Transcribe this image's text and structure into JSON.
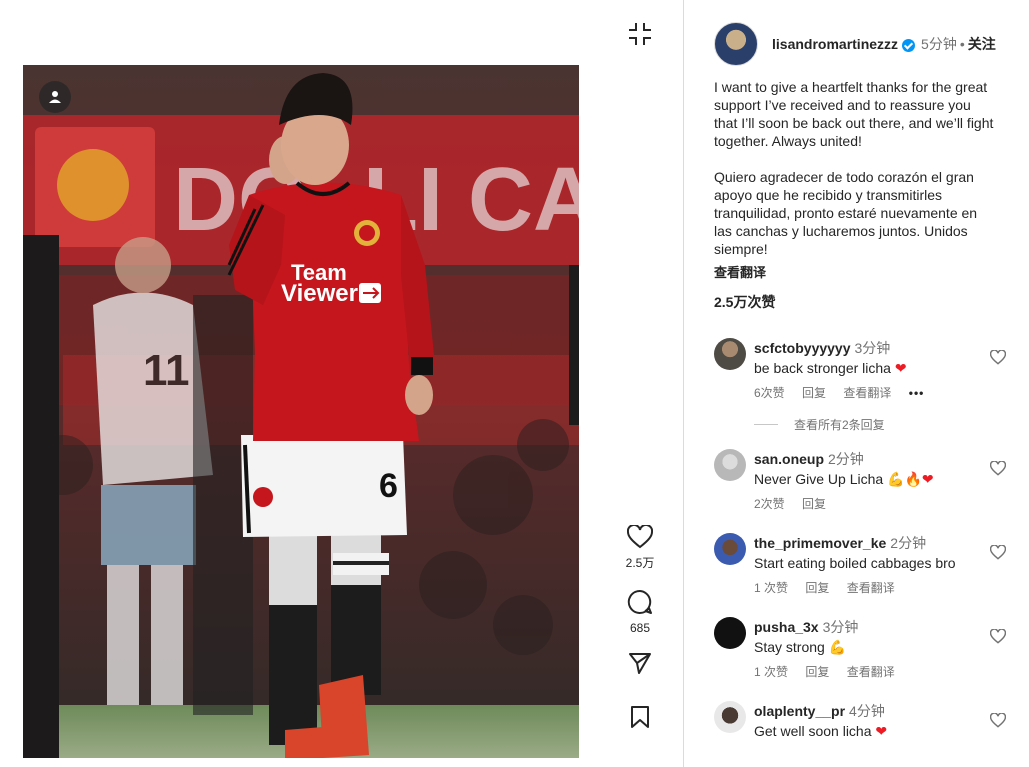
{
  "post": {
    "author": "lisandromartinezzz",
    "time": "5分钟",
    "dot": "•",
    "follow_label": "关注",
    "caption": "I want to give a heartfelt thanks for the great support I’ve received and to reassure you that I’ll soon be back out there, and we’ll fight together. Always united!\n\nQuiero agradecer de todo corazón el gran apoyo que he recibido y transmitirles tranquilidad, pronto estaré nuevamente en las canchas y lucharemos juntos. Unidos siempre!",
    "see_translation": "查看翻译",
    "likes_text": "2.5万次赞"
  },
  "actions": {
    "like_count": "2.5万",
    "comment_count": "685"
  },
  "media": {
    "sponsor_line1": "Team",
    "sponsor_line2": "Viewer",
    "shirt_number_player": "6",
    "shirt_number_background": "11"
  },
  "comments": [
    {
      "user": "scfctobyyyyyy",
      "time": "3分钟",
      "text": "be back stronger licha ",
      "emoji": "❤",
      "likes": "6次赞",
      "reply": "回复",
      "translate": "查看翻译",
      "more": "•••"
    },
    {
      "user": "san.oneup",
      "time": "2分钟",
      "text": "Never Give Up Licha ",
      "emoji": "💪🔥❤",
      "likes": "2次赞",
      "reply": "回复"
    },
    {
      "user": "the_primemover_ke",
      "time": "2分钟",
      "text": "Start eating boiled cabbages bro",
      "likes": "1 次赞",
      "reply": "回复",
      "translate": "查看翻译"
    },
    {
      "user": "pusha_3x",
      "time": "3分钟",
      "text": "Stay strong ",
      "emoji": "💪",
      "likes": "1 次赞",
      "reply": "回复",
      "translate": "查看翻译"
    },
    {
      "user": "olaplenty__pr",
      "time": "4分钟",
      "text": "Get well soon licha ",
      "emoji": "❤"
    }
  ],
  "view_replies": "查看所有2条回复",
  "colors": {
    "accent_blue": "#0095f6",
    "text": "#262626",
    "muted": "#737373",
    "border": "#dbdbdb",
    "heart_red": "#ed1c24",
    "shirt_red": "#c4161c"
  },
  "icons": [
    "collapse-icon",
    "user-tag-icon",
    "heart-icon",
    "comment-icon",
    "share-icon",
    "bookmark-icon",
    "verified-badge-icon",
    "more-options-icon"
  ]
}
